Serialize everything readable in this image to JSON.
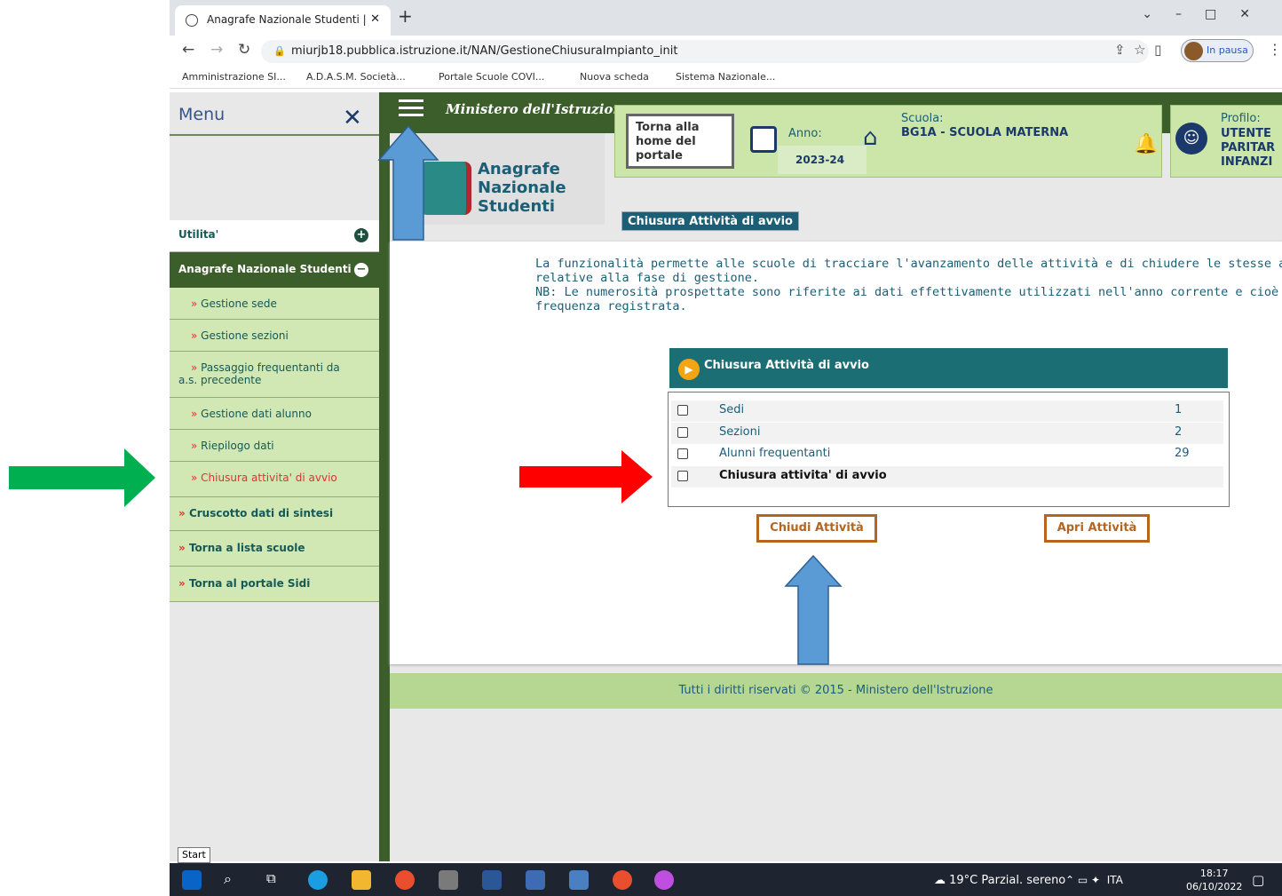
{
  "browser": {
    "tab_title": "Anagrafe Nazionale Studenti |",
    "url": "miurjb18.pubblica.istruzione.it/NAN/GestioneChiusuraImpianto_init",
    "profile_label": "In pausa",
    "bookmarks": [
      "Amministrazione SI...",
      "A.D.A.S.M. Società...",
      "Portale Scuole COVI...",
      "Nuova scheda",
      "Sistema Nazionale..."
    ]
  },
  "sidebar": {
    "title": "Menu",
    "items": [
      {
        "label": "Utilita'"
      },
      {
        "label": "Anagrafe Nazionale Studenti"
      },
      {
        "label": "Gestione sede"
      },
      {
        "label": "Gestione sezioni"
      },
      {
        "label": "Passaggio frequentanti da a.s. precedente"
      },
      {
        "label": "Gestione dati alunno"
      },
      {
        "label": "Riepilogo dati"
      },
      {
        "label": "Chiusura attivita' di avvio"
      },
      {
        "label": "Cruscotto dati di sintesi"
      },
      {
        "label": "Torna a lista scuole"
      },
      {
        "label": "Torna al portale Sidi"
      }
    ]
  },
  "header": {
    "ministry": "Ministero dell'Istruzione",
    "home_button": "Torna alla home del portale",
    "anno_label": "Anno:",
    "anno_value": "2023-24",
    "scuola_label": "Scuola:",
    "scuola_value": "BG1A - SCUOLA MATERNA",
    "profilo_label": "Profilo:",
    "profilo_value": "UTENTE PARITAR INFANZI",
    "app_name": "Anagrafe Nazionale Studenti"
  },
  "page": {
    "title": "Chiusura Attività di avvio",
    "intro_line1": "La funzionalità permette alle scuole di tracciare l'avanzamento delle attività e di chiudere le stesse al fine di attivare le op",
    "intro_line2": "relative alla fase di gestione.",
    "intro_line3": "NB: Le numerosità prospettate sono riferite ai dati effettivamente utilizzati nell'anno corrente e cioè legati all'esistenza d",
    "intro_line4": "frequenza registrata.",
    "table_title": "Chiusura Attività di avvio",
    "rows": [
      {
        "label": "Sedi",
        "value": "1"
      },
      {
        "label": "Sezioni",
        "value": "2"
      },
      {
        "label": "Alunni frequentanti",
        "value": "29"
      },
      {
        "label": "Chiusura attivita' di avvio",
        "value": ""
      }
    ],
    "close_button": "Chiudi Attività",
    "open_button": "Apri Attività",
    "footer": "Tutti i diritti riservati © 2015 -  Ministero dell'Istruzione"
  },
  "taskbar": {
    "start_tooltip": "Start",
    "weather": "19°C  Parzial. sereno",
    "lang": "ITA",
    "time": "18:17",
    "date": "06/10/2022"
  },
  "colors": {
    "header_green": "#3b5e2b",
    "teal": "#1b5e75",
    "orange_button": "#b5651d",
    "annotation_green_arrow": "#00b050",
    "annotation_red_arrow": "#ff0000",
    "annotation_blue_arrow": "#5b9bd5"
  }
}
